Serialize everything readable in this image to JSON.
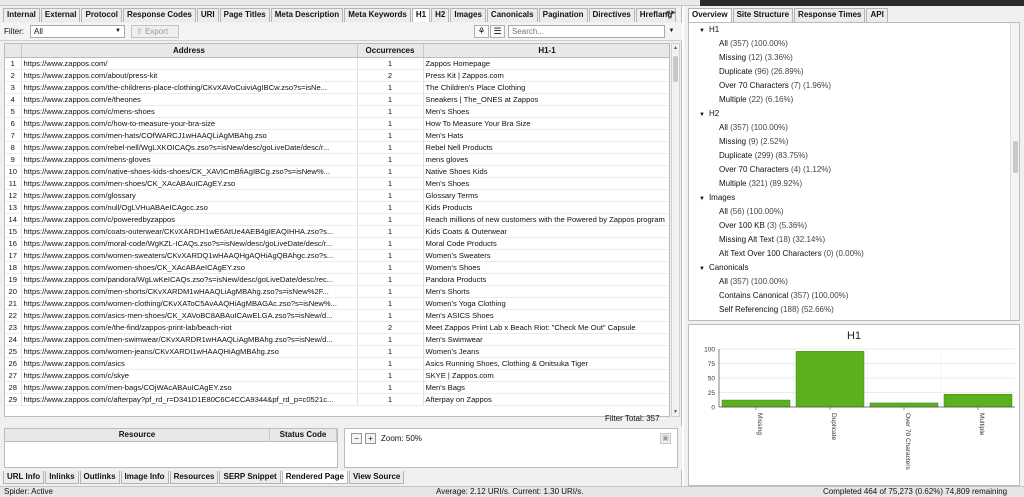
{
  "tabs": [
    "Internal",
    "External",
    "Protocol",
    "Response Codes",
    "URI",
    "Page Titles",
    "Meta Description",
    "Meta Keywords",
    "H1",
    "H2",
    "Images",
    "Canonicals",
    "Pagination",
    "Directives",
    "Hreflang"
  ],
  "active_tab": "H1",
  "toolbar": {
    "filter_label": "Filter:",
    "filter_value": "All",
    "export_label": "Export",
    "search_placeholder": "Search..."
  },
  "table": {
    "columns": [
      "",
      "Address",
      "Occurrences",
      "H1-1"
    ],
    "rows": [
      [
        "1",
        "https://www.zappos.com/",
        "1",
        "Zappos Homepage"
      ],
      [
        "2",
        "https://www.zappos.com/about/press-kit",
        "2",
        "Press Kit | Zappos.com"
      ],
      [
        "3",
        "https://www.zappos.com/the-childrens-place-clothing/CKvXAVoCuiviAgIBCw.zso?s=isNe...",
        "1",
        "The Children's Place Clothing"
      ],
      [
        "4",
        "https://www.zappos.com/e/theones",
        "1",
        "Sneakers | The_ONES at Zappos"
      ],
      [
        "5",
        "https://www.zappos.com/c/mens-shoes",
        "1",
        "Men's Shoes"
      ],
      [
        "6",
        "https://www.zappos.com/c/how-to-measure-your-bra-size",
        "1",
        "How To Measure Your Bra Size"
      ],
      [
        "7",
        "https://www.zappos.com/men-hats/COfWARCJ1wHAAQLiAgMBAhg.zso",
        "1",
        "Men's Hats"
      ],
      [
        "8",
        "https://www.zappos.com/rebel-nell/WgLXKOICAQs.zso?s=isNew/desc/goLiveDate/desc/r...",
        "1",
        "Rebel Nell Products"
      ],
      [
        "9",
        "https://www.zappos.com/mens-gloves",
        "1",
        "mens gloves"
      ],
      [
        "10",
        "https://www.zappos.com/native-shoes-kids-shoes/CK_XAVICmBfiAgIBCg.zso?s=isNew%...",
        "1",
        "Native Shoes Kids"
      ],
      [
        "11",
        "https://www.zappos.com/men-shoes/CK_XAcABAuICAgEY.zso",
        "1",
        "Men's Shoes"
      ],
      [
        "12",
        "https://www.zappos.com/glossary",
        "1",
        "Glossary Terms"
      ],
      [
        "13",
        "https://www.zappos.com/null/OgLVHuABAeICAgcc.zso",
        "1",
        "Kids Products"
      ],
      [
        "14",
        "https://www.zappos.com/c/poweredbyzappos",
        "1",
        "Reach millions of new customers with the Powered by Zappos program"
      ],
      [
        "15",
        "https://www.zappos.com/coats-outerwear/CKvXARDH1wE6AtUe4AEB4gIEAQIHHA.zso?s...",
        "1",
        "Kids Coats & Outerwear"
      ],
      [
        "16",
        "https://www.zappos.com/moral-code/WgKZL-ICAQs.zso?s=isNew/desc/goLiveDate/desc/r...",
        "1",
        "Moral Code Products"
      ],
      [
        "17",
        "https://www.zappos.com/women-sweaters/CKvXARDQ1wHAAQHgAQHiAgQBAhgc.zso?s...",
        "1",
        "Women's Sweaters"
      ],
      [
        "18",
        "https://www.zappos.com/women-shoes/CK_XAcABAeICAgEY.zso",
        "1",
        "Women's Shoes"
      ],
      [
        "19",
        "https://www.zappos.com/pandora/WgLwKeICAQs.zso?s=isNew/desc/goLiveDate/desc/rec...",
        "1",
        "Pandora Products"
      ],
      [
        "20",
        "https://www.zappos.com/men-shorts/CKvXARDM1wHAAQLiAgMBAhg.zso?s=isNew%2F...",
        "1",
        "Men's Shorts"
      ],
      [
        "21",
        "https://www.zappos.com/women-clothing/CKvXAToC5AvAAQHiAgMBAGAc.zso?s=isNew%...",
        "1",
        "Women's Yoga Clothing"
      ],
      [
        "22",
        "https://www.zappos.com/asics-men-shoes/CK_XAVoBC8ABAuICAwELGA.zso?s=isNew/d...",
        "1",
        "Men's ASICS Shoes"
      ],
      [
        "23",
        "https://www.zappos.com/e/the-find/zappos-print-lab/beach-riot",
        "2",
        "Meet Zappos Print Lab x Beach Riot: \"Check Me Out\" Capsule"
      ],
      [
        "24",
        "https://www.zappos.com/men-swimwear/CKvXARDR1wHAAQLiAgMBAhg.zso?s=isNew/d...",
        "1",
        "Men's Swimwear"
      ],
      [
        "25",
        "https://www.zappos.com/women-jeans/CKvXARDI1wHAAQHiAgMBAhg.zso",
        "1",
        "Women's Jeans"
      ],
      [
        "26",
        "https://www.zappos.com/asics",
        "1",
        "Asics Running Shoes, Clothing & Onitsuka Tiger"
      ],
      [
        "27",
        "https://www.zappos.com/c/skye",
        "1",
        "SKYE | Zappos.com"
      ],
      [
        "28",
        "https://www.zappos.com/men-bags/COjWAcABAuICAgEY.zso",
        "1",
        "Men's Bags"
      ],
      [
        "29",
        "https://www.zappos.com/c/afterpay?pf_rd_r=D341D1E80C6C4CCA9344&pf_rd_p=c0521c...",
        "1",
        "Afterpay on Zappos"
      ]
    ]
  },
  "filter_total_label": "Filter Total:",
  "filter_total_value": "357",
  "resources": {
    "col1": "Resource",
    "col2": "Status Code"
  },
  "zoom": {
    "label": "Zoom: 50%"
  },
  "bottom_tabs": [
    "URL Info",
    "Inlinks",
    "Outlinks",
    "Image Info",
    "Resources",
    "SERP Snippet",
    "Rendered Page",
    "View Source"
  ],
  "active_bottom_tab": "Rendered Page",
  "right_tabs": [
    "Overview",
    "Site Structure",
    "Response Times",
    "API"
  ],
  "active_right_tab": "Overview",
  "tree": [
    {
      "title": "H1",
      "items": [
        {
          "label": "All",
          "count": "(357) (100.00%)"
        },
        {
          "label": "Missing",
          "count": "(12) (3.36%)"
        },
        {
          "label": "Duplicate",
          "count": "(96) (26.89%)"
        },
        {
          "label": "Over 70 Characters",
          "count": "(7) (1.96%)"
        },
        {
          "label": "Multiple",
          "count": "(22) (6.16%)"
        }
      ]
    },
    {
      "title": "H2",
      "items": [
        {
          "label": "All",
          "count": "(357) (100.00%)"
        },
        {
          "label": "Missing",
          "count": "(9) (2.52%)"
        },
        {
          "label": "Duplicate",
          "count": "(299) (83.75%)"
        },
        {
          "label": "Over 70 Characters",
          "count": "(4) (1.12%)"
        },
        {
          "label": "Multiple",
          "count": "(321) (89.92%)"
        }
      ]
    },
    {
      "title": "Images",
      "items": [
        {
          "label": "All",
          "count": "(56) (100.00%)"
        },
        {
          "label": "Over 100 KB",
          "count": "(3) (5.36%)"
        },
        {
          "label": "Missing Alt Text",
          "count": "(18) (32.14%)"
        },
        {
          "label": "Alt Text Over 100 Characters",
          "count": "(0) (0.00%)"
        }
      ]
    },
    {
      "title": "Canonicals",
      "items": [
        {
          "label": "All",
          "count": "(357) (100.00%)"
        },
        {
          "label": "Contains Canonical",
          "count": "(357) (100.00%)"
        },
        {
          "label": "Self Referencing",
          "count": "(188) (52.66%)"
        }
      ]
    }
  ],
  "chart_data": {
    "type": "bar",
    "title": "H1",
    "categories": [
      "Missing",
      "Duplicate",
      "Over 70 Characters",
      "Multiple"
    ],
    "values": [
      12,
      96,
      7,
      22
    ],
    "ylim": [
      0,
      100
    ],
    "yticks": [
      "0",
      "25",
      "50",
      "75",
      "100"
    ],
    "grid": true,
    "bar_color": "#5cb01e"
  },
  "status": {
    "left": "Spider: Active",
    "middle": "Average: 2.12 URI/s. Current: 1.30 URI/s.",
    "right": "Completed 464 of 75,273 (0.62%) 74,809 remaining"
  }
}
